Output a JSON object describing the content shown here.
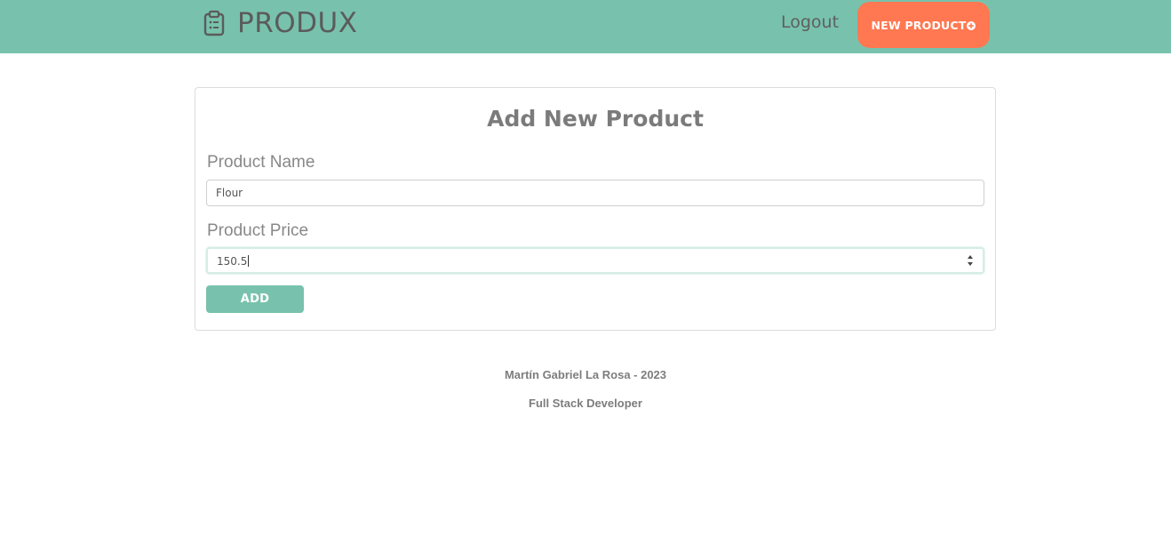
{
  "navbar": {
    "brand": "PRODUX",
    "brand_icon": "clipboard-list-icon",
    "logout_label": "Logout",
    "new_product_label": "NEW PRODUCT",
    "new_product_icon": "plus-circle-icon",
    "background_color": "#78c2ad",
    "new_product_color": "#ff7851"
  },
  "form": {
    "title": "Add New Product",
    "name_label": "Product Name",
    "name_value": "Flour",
    "price_label": "Product Price",
    "price_value": "150.5",
    "submit_label": "ADD",
    "submit_color": "#78c2ad"
  },
  "footer": {
    "author": "Martín Gabriel La Rosa - 2023",
    "role": "Full Stack Developer"
  }
}
